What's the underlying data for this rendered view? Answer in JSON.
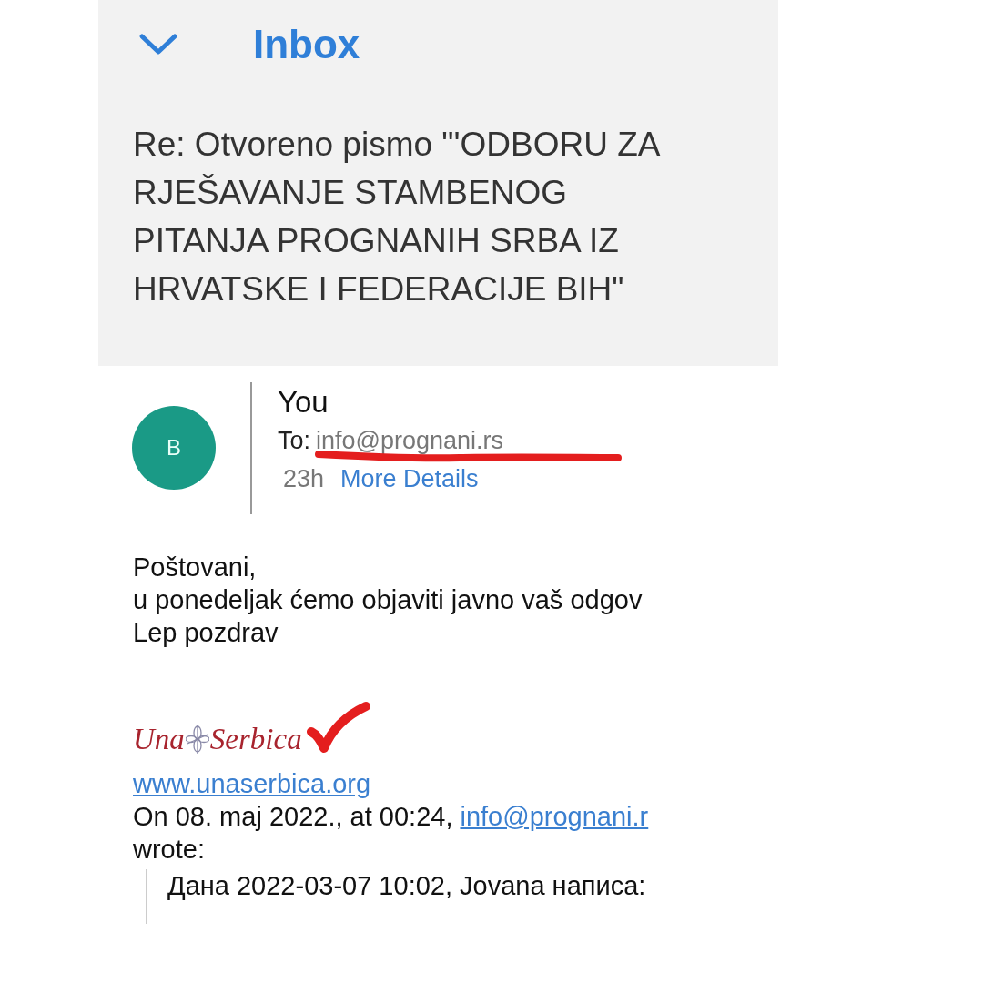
{
  "header": {
    "title": "Inbox"
  },
  "subject": "Re: Otvoreno pismo  \"'ODBORU ZA RJEŠAVANJE STAMBENOG PITANJA PROGNANIH SRBA IZ HRVATSKE I FEDERACIJE BIH\"",
  "sender": {
    "initial": "B",
    "name": "You",
    "to_label": "To:",
    "to_address": "info@prognani.rs",
    "time": "23h",
    "details_link": "More Details"
  },
  "body": [
    "Poštovani,",
    "u ponedeljak ćemo objaviti javno vaš odgov",
    "Lep pozdrav"
  ],
  "signature": {
    "logo_left": "Una",
    "logo_right": "Serbica",
    "website": "www.unaserbica.org"
  },
  "quote_header": {
    "text": "On 08. maj 2022., at 00:24,",
    "link": "info@prognani.r",
    "suffix": "wrote:"
  },
  "quoted": [
    "Дана 2022-03-07 10:02, Jovana написа:"
  ]
}
